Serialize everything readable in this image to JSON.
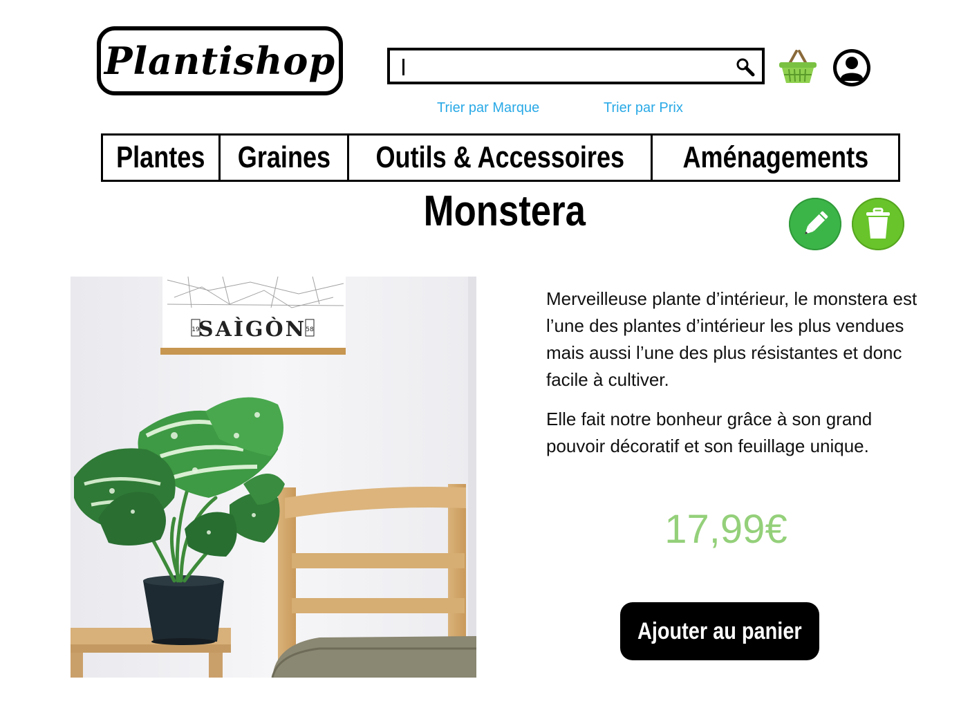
{
  "brand": {
    "logo_text": "Plantishop"
  },
  "search": {
    "value": "",
    "placeholder": "",
    "icon": "search-icon"
  },
  "header_icons": {
    "cart": "basket-icon",
    "account": "user-icon"
  },
  "sort_links": {
    "brand": "Trier par Marque",
    "price": "Trier par Prix"
  },
  "nav": {
    "items": [
      {
        "label": "Plantes"
      },
      {
        "label": "Graines"
      },
      {
        "label": "Outils & Accessoires"
      },
      {
        "label": "Aménagements"
      }
    ]
  },
  "product": {
    "name": "Monstera",
    "description": [
      "Merveilleuse plante d’intérieur, le monstera est l’une des plantes d’intérieur les plus vendues mais aussi l’une des plus résistantes et donc facile à cultiver.",
      "Elle fait notre bonheur grâce à son grand pouvoir décoratif et son feuillage unique."
    ],
    "price": "17,99€",
    "add_to_cart_label": "Ajouter au panier",
    "poster_text": "SAÌGÒN",
    "poster_year_left": "19",
    "poster_year_right": "58"
  },
  "admin_actions": {
    "edit": "pencil-icon",
    "delete": "trash-icon"
  },
  "colors": {
    "link": "#29a9e6",
    "price": "#94d07a",
    "edit_button": "#3cb548",
    "delete_button": "#68c42a",
    "cart_icon": "#7ac142"
  }
}
